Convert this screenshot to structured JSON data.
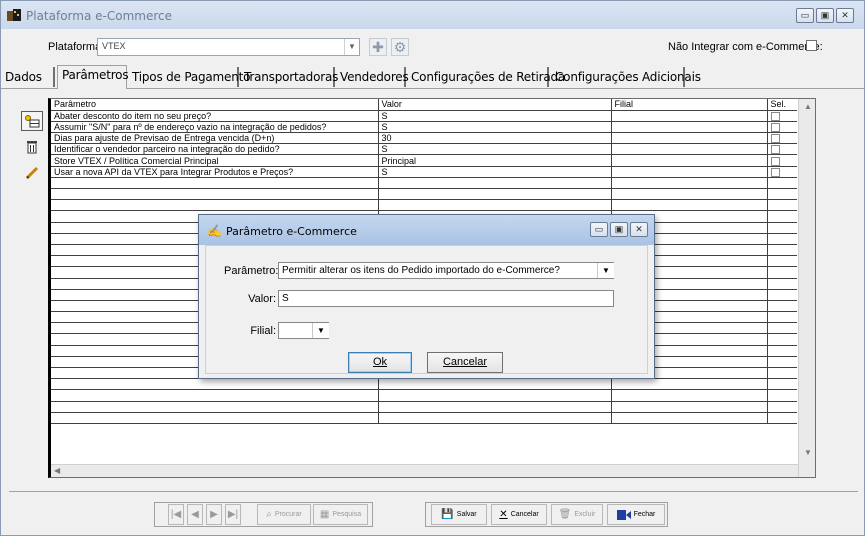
{
  "window": {
    "title": "Plataforma e-Commerce",
    "controls": [
      "minimize",
      "maximize",
      "close"
    ]
  },
  "header": {
    "platform_label": "Plataforma:",
    "platform_value": "VTEX",
    "no_integrate_label": "Não Integrar com e-Commerce:"
  },
  "tabs": [
    {
      "label": "Dados"
    },
    {
      "label": "Parâmetros",
      "active": true
    },
    {
      "label": "Tipos de Pagamento"
    },
    {
      "label": "Transportadoras"
    },
    {
      "label": "Vendedores"
    },
    {
      "label": "Configurações de Retirada"
    },
    {
      "label": "Configurações Adicionais"
    }
  ],
  "grid": {
    "headers": {
      "param": "Parâmetro",
      "valor": "Valor",
      "filial": "Filial",
      "sel": "Sel."
    },
    "rows": [
      {
        "param": "Abater desconto do item no seu preço?",
        "valor": "S",
        "filial": ""
      },
      {
        "param": "Assumir \"S/N\" para nº de endereço vazio na integração de pedidos?",
        "valor": "S",
        "filial": ""
      },
      {
        "param": "Dias para ajuste de Previsao de Entrega vencida (D+n)",
        "valor": "30",
        "filial": ""
      },
      {
        "param": "Identificar o vendedor parceiro na integração do pedido?",
        "valor": "S",
        "filial": ""
      },
      {
        "param": "Store VTEX / Política Comercial Principal",
        "valor": "Principal",
        "filial": ""
      },
      {
        "param": "Usar a nova API da VTEX para Integrar Produtos e Preços?",
        "valor": "S",
        "filial": ""
      }
    ]
  },
  "dialog": {
    "title": "Parâmetro e-Commerce",
    "param_label": "Parâmetro:",
    "param_value": "Permitir alterar os itens do Pedido importado do e-Commerce?",
    "valor_label": "Valor:",
    "valor_value": "S",
    "filial_label": "Filial:",
    "filial_value": "",
    "ok_label": "Ok",
    "cancel_label": "Cancelar"
  },
  "bottom": {
    "procurar": "Procurar",
    "pesquisa": "Pesquisa",
    "salvar": "Salvar",
    "cancelar": "Cancelar",
    "excluir": "Excluir",
    "fechar": "Fechar"
  },
  "colors": {
    "title_bg": "#c9d8ec",
    "dialog_title_bg": "#a9c3e4",
    "accent": "#1e3f9e"
  }
}
